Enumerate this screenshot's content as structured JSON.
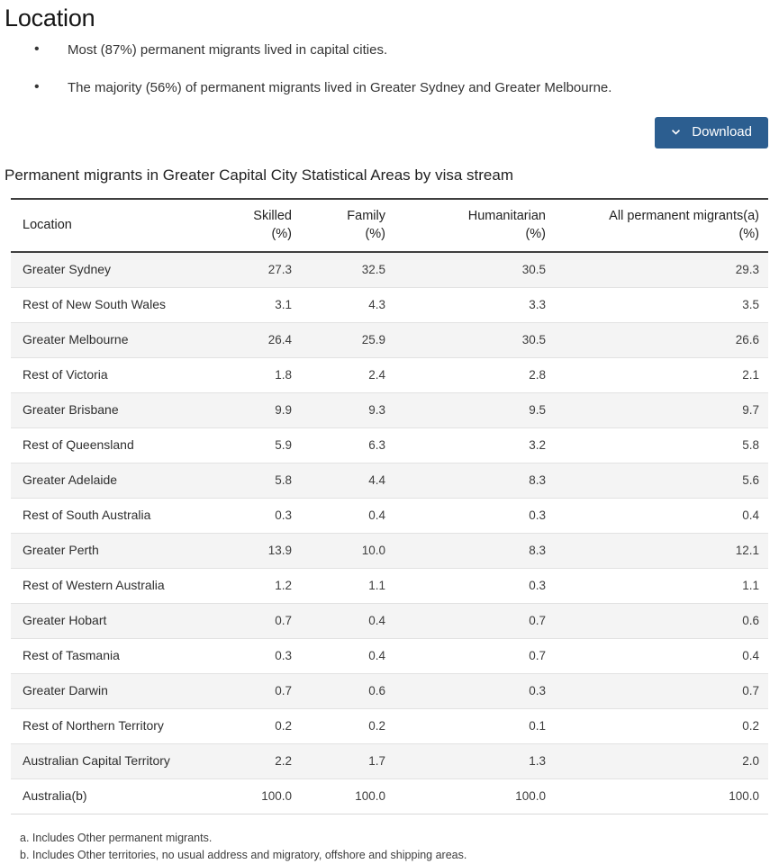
{
  "section": {
    "title": "Location",
    "bullets": [
      "Most (87%) permanent migrants lived in capital cities.",
      "The majority (56%) of permanent migrants lived in Greater Sydney and Greater Melbourne."
    ]
  },
  "download": {
    "label": "Download",
    "icon": "chevron-down-icon",
    "background_color": "#2c5e90",
    "text_color": "#ffffff"
  },
  "table": {
    "caption": "Permanent migrants in Greater Capital City Statistical Areas by visa stream",
    "columns": [
      {
        "title": "Location",
        "unit": "",
        "align": "left"
      },
      {
        "title": "Skilled",
        "unit": "(%)",
        "align": "right"
      },
      {
        "title": "Family",
        "unit": "(%)",
        "align": "right"
      },
      {
        "title": "Humanitarian",
        "unit": "(%)",
        "align": "right"
      },
      {
        "title": "All permanent migrants(a)",
        "unit": "(%)",
        "align": "right"
      }
    ],
    "rows": [
      {
        "location": "Greater Sydney",
        "skilled": "27.3",
        "family": "32.5",
        "humanitarian": "30.5",
        "all": "29.3"
      },
      {
        "location": "Rest of New South Wales",
        "skilled": "3.1",
        "family": "4.3",
        "humanitarian": "3.3",
        "all": "3.5"
      },
      {
        "location": "Greater Melbourne",
        "skilled": "26.4",
        "family": "25.9",
        "humanitarian": "30.5",
        "all": "26.6"
      },
      {
        "location": "Rest of Victoria",
        "skilled": "1.8",
        "family": "2.4",
        "humanitarian": "2.8",
        "all": "2.1"
      },
      {
        "location": "Greater Brisbane",
        "skilled": "9.9",
        "family": "9.3",
        "humanitarian": "9.5",
        "all": "9.7"
      },
      {
        "location": "Rest of Queensland",
        "skilled": "5.9",
        "family": "6.3",
        "humanitarian": "3.2",
        "all": "5.8"
      },
      {
        "location": "Greater Adelaide",
        "skilled": "5.8",
        "family": "4.4",
        "humanitarian": "8.3",
        "all": "5.6"
      },
      {
        "location": "Rest of South Australia",
        "skilled": "0.3",
        "family": "0.4",
        "humanitarian": "0.3",
        "all": "0.4"
      },
      {
        "location": "Greater Perth",
        "skilled": "13.9",
        "family": "10.0",
        "humanitarian": "8.3",
        "all": "12.1"
      },
      {
        "location": "Rest of Western Australia",
        "skilled": "1.2",
        "family": "1.1",
        "humanitarian": "0.3",
        "all": "1.1"
      },
      {
        "location": "Greater Hobart",
        "skilled": "0.7",
        "family": "0.4",
        "humanitarian": "0.7",
        "all": "0.6"
      },
      {
        "location": "Rest of Tasmania",
        "skilled": "0.3",
        "family": "0.4",
        "humanitarian": "0.7",
        "all": "0.4"
      },
      {
        "location": "Greater Darwin",
        "skilled": "0.7",
        "family": "0.6",
        "humanitarian": "0.3",
        "all": "0.7"
      },
      {
        "location": "Rest of Northern Territory",
        "skilled": "0.2",
        "family": "0.2",
        "humanitarian": "0.1",
        "all": "0.2"
      },
      {
        "location": "Australian Capital Territory",
        "skilled": "2.2",
        "family": "1.7",
        "humanitarian": "1.3",
        "all": "2.0"
      },
      {
        "location": "Australia(b)",
        "skilled": "100.0",
        "family": "100.0",
        "humanitarian": "100.0",
        "all": "100.0"
      }
    ]
  },
  "footnotes": [
    "a. Includes Other permanent migrants.",
    "b. Includes Other territories, no usual address and migratory, offshore and shipping areas."
  ]
}
